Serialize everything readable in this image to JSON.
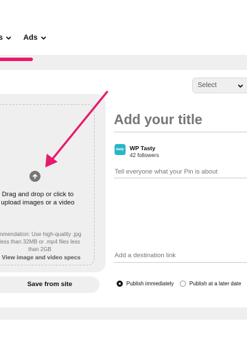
{
  "nav": {
    "items": [
      {
        "label": "s"
      },
      {
        "label": "Ads"
      }
    ]
  },
  "board_select": {
    "value": "Select"
  },
  "upload": {
    "drop_text_line1": "Drag and drop or click to",
    "drop_text_line2": "upload images or a video",
    "rec_line1": "mmendation: Use high-quality .jpg",
    "rec_line2": "less than 32MB or .mp4 files less",
    "rec_line3": "than 2GB",
    "specs_link": "View image and video specs"
  },
  "save_from_site": "Save from site",
  "pin": {
    "title_placeholder": "Add your title",
    "account_name": "WP Tasty",
    "account_followers": "42 followers",
    "avatar_text": "tasty",
    "description_placeholder": "Tell everyone what your Pin is about",
    "destination_placeholder": "Add a destination link"
  },
  "publish": {
    "options": [
      {
        "label": "Publish immediately",
        "selected": true
      },
      {
        "label": "Publish at a later date",
        "selected": false
      }
    ]
  },
  "colors": {
    "accent": "#e9196d",
    "panel": "#efefef",
    "avatar": "#29b6c8"
  }
}
